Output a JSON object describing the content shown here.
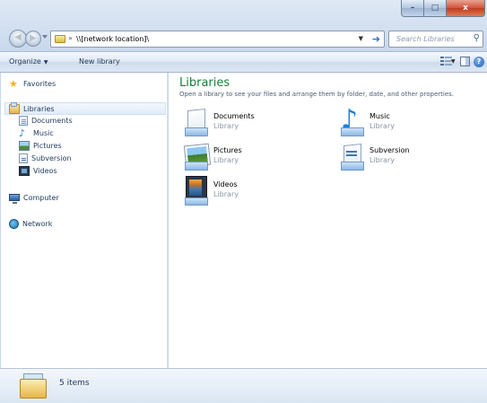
{
  "window": {
    "minimize_glyph": "–",
    "maximize_glyph": "□",
    "close_glyph": "x"
  },
  "navigation": {
    "address": "\\\\[network location]\\",
    "address_chevron": "»",
    "search_placeholder": "Search Libraries"
  },
  "commandbar": {
    "organize_label": "Organize",
    "new_library_label": "New library",
    "help_glyph": "?"
  },
  "navpane": {
    "favorites": "Favorites",
    "libraries": "Libraries",
    "library_items": [
      "Documents",
      "Music",
      "Pictures",
      "Subversion",
      "Videos"
    ],
    "computer": "Computer",
    "network": "Network"
  },
  "content": {
    "title": "Libraries",
    "subtitle": "Open a library to see your files and arrange them by folder, date, and other properties.",
    "items": [
      {
        "name": "Documents",
        "type": "Library",
        "icon": "documents-library-icon"
      },
      {
        "name": "Music",
        "type": "Library",
        "icon": "music-library-icon"
      },
      {
        "name": "Pictures",
        "type": "Library",
        "icon": "pictures-library-icon"
      },
      {
        "name": "Subversion",
        "type": "Library",
        "icon": "subversion-library-icon"
      },
      {
        "name": "Videos",
        "type": "Library",
        "icon": "videos-library-icon"
      }
    ]
  },
  "details": {
    "item_count": "5 items"
  },
  "colors": {
    "title_green": "#1e7d3c",
    "close_red": "#c23b20",
    "frame_blue": "#c7d7ec"
  }
}
